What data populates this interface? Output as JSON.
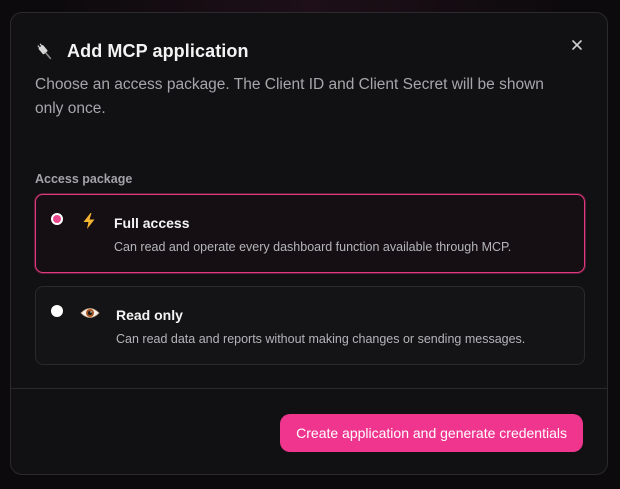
{
  "dialog": {
    "title": "Add MCP application",
    "subtitle": "Choose an access package. The Client ID and Client Secret will be shown only once.",
    "close_icon": "close-icon",
    "title_icon": "plug-icon"
  },
  "access_package": {
    "label": "Access package",
    "options": [
      {
        "title": "Full access",
        "description": "Can read and operate every dashboard function available through MCP.",
        "icon": "lightning-icon",
        "selected": true
      },
      {
        "title": "Read only",
        "description": "Can read data and reports without making changes or sending messages.",
        "icon": "eye-icon",
        "selected": false
      }
    ]
  },
  "footer": {
    "create_label": "Create application and generate credentials"
  },
  "colors": {
    "accent": "#f0358f",
    "background": "#111012",
    "border": "#2c2a2d"
  }
}
